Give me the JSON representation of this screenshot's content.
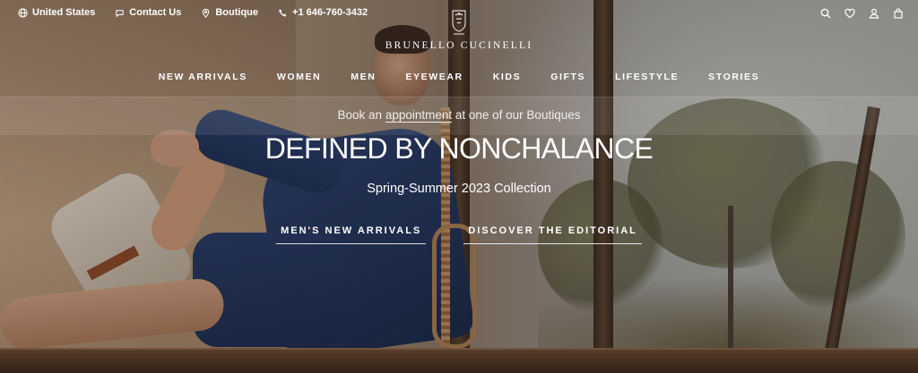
{
  "utility": {
    "country": "United States",
    "contact": "Contact Us",
    "boutique": "Boutique",
    "phone": "+1 646-760-3432"
  },
  "header_icons": [
    "search-icon",
    "heart-icon",
    "user-icon",
    "bag-icon"
  ],
  "brand": {
    "name": "BRUNELLO CUCINELLI"
  },
  "nav": [
    "NEW ARRIVALS",
    "WOMEN",
    "MEN",
    "EYEWEAR",
    "KIDS",
    "GIFTS",
    "LIFESTYLE",
    "STORIES"
  ],
  "hero": {
    "appointment_prefix": "Book an ",
    "appointment_link": "appointment",
    "appointment_suffix": " at one of our Boutiques",
    "headline": "DEFINED BY NONCHALANCE",
    "subtitle": "Spring-Summer 2023 Collection",
    "cta_primary": "MEN'S NEW ARRIVALS",
    "cta_secondary": "DISCOVER THE EDITORIAL"
  },
  "colors": {
    "text": "#ffffff",
    "navy_knit": "#243459",
    "wood": "#5a4332"
  }
}
